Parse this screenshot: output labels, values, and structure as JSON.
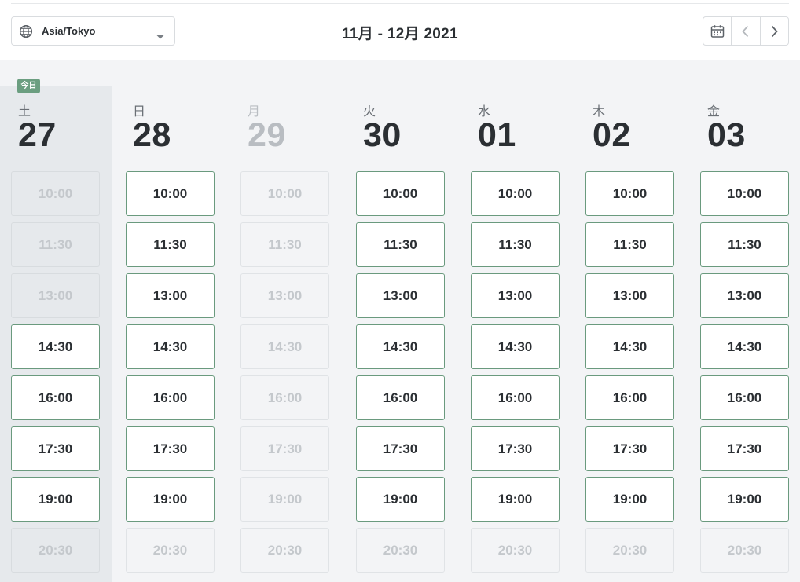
{
  "header": {
    "timezone": "Asia/Tokyo",
    "range_title": "11月 - 12月 2021"
  },
  "today_badge": "今日",
  "days": [
    {
      "dow": "土",
      "date": "27",
      "today": true,
      "closed": false,
      "slots": [
        {
          "time": "10:00",
          "available": false
        },
        {
          "time": "11:30",
          "available": false
        },
        {
          "time": "13:00",
          "available": false
        },
        {
          "time": "14:30",
          "available": true
        },
        {
          "time": "16:00",
          "available": true
        },
        {
          "time": "17:30",
          "available": true
        },
        {
          "time": "19:00",
          "available": true
        },
        {
          "time": "20:30",
          "available": false
        }
      ]
    },
    {
      "dow": "日",
      "date": "28",
      "today": false,
      "closed": false,
      "slots": [
        {
          "time": "10:00",
          "available": true
        },
        {
          "time": "11:30",
          "available": true
        },
        {
          "time": "13:00",
          "available": true
        },
        {
          "time": "14:30",
          "available": true
        },
        {
          "time": "16:00",
          "available": true
        },
        {
          "time": "17:30",
          "available": true
        },
        {
          "time": "19:00",
          "available": true
        },
        {
          "time": "20:30",
          "available": false
        }
      ]
    },
    {
      "dow": "月",
      "date": "29",
      "today": false,
      "closed": true,
      "slots": [
        {
          "time": "10:00",
          "available": false
        },
        {
          "time": "11:30",
          "available": false
        },
        {
          "time": "13:00",
          "available": false
        },
        {
          "time": "14:30",
          "available": false
        },
        {
          "time": "16:00",
          "available": false
        },
        {
          "time": "17:30",
          "available": false
        },
        {
          "time": "19:00",
          "available": false
        },
        {
          "time": "20:30",
          "available": false
        }
      ]
    },
    {
      "dow": "火",
      "date": "30",
      "today": false,
      "closed": false,
      "slots": [
        {
          "time": "10:00",
          "available": true
        },
        {
          "time": "11:30",
          "available": true
        },
        {
          "time": "13:00",
          "available": true
        },
        {
          "time": "14:30",
          "available": true
        },
        {
          "time": "16:00",
          "available": true
        },
        {
          "time": "17:30",
          "available": true
        },
        {
          "time": "19:00",
          "available": true
        },
        {
          "time": "20:30",
          "available": false
        }
      ]
    },
    {
      "dow": "水",
      "date": "01",
      "today": false,
      "closed": false,
      "slots": [
        {
          "time": "10:00",
          "available": true
        },
        {
          "time": "11:30",
          "available": true
        },
        {
          "time": "13:00",
          "available": true
        },
        {
          "time": "14:30",
          "available": true
        },
        {
          "time": "16:00",
          "available": true
        },
        {
          "time": "17:30",
          "available": true
        },
        {
          "time": "19:00",
          "available": true
        },
        {
          "time": "20:30",
          "available": false
        }
      ]
    },
    {
      "dow": "木",
      "date": "02",
      "today": false,
      "closed": false,
      "slots": [
        {
          "time": "10:00",
          "available": true
        },
        {
          "time": "11:30",
          "available": true
        },
        {
          "time": "13:00",
          "available": true
        },
        {
          "time": "14:30",
          "available": true
        },
        {
          "time": "16:00",
          "available": true
        },
        {
          "time": "17:30",
          "available": true
        },
        {
          "time": "19:00",
          "available": true
        },
        {
          "time": "20:30",
          "available": false
        }
      ]
    },
    {
      "dow": "金",
      "date": "03",
      "today": false,
      "closed": false,
      "slots": [
        {
          "time": "10:00",
          "available": true
        },
        {
          "time": "11:30",
          "available": true
        },
        {
          "time": "13:00",
          "available": true
        },
        {
          "time": "14:30",
          "available": true
        },
        {
          "time": "16:00",
          "available": true
        },
        {
          "time": "17:30",
          "available": true
        },
        {
          "time": "19:00",
          "available": true
        },
        {
          "time": "20:30",
          "available": false
        }
      ]
    }
  ],
  "colors": {
    "accent": "#6b9e80",
    "open_border": "#6a9a7e",
    "board_bg": "#f3f4f6",
    "today_bg": "#e6e9ec"
  },
  "icons": {
    "timezone": "globe-icon",
    "dropdown": "chevron-down-icon",
    "calendar": "calendar-icon",
    "prev": "chevron-left-icon",
    "next": "chevron-right-icon"
  }
}
